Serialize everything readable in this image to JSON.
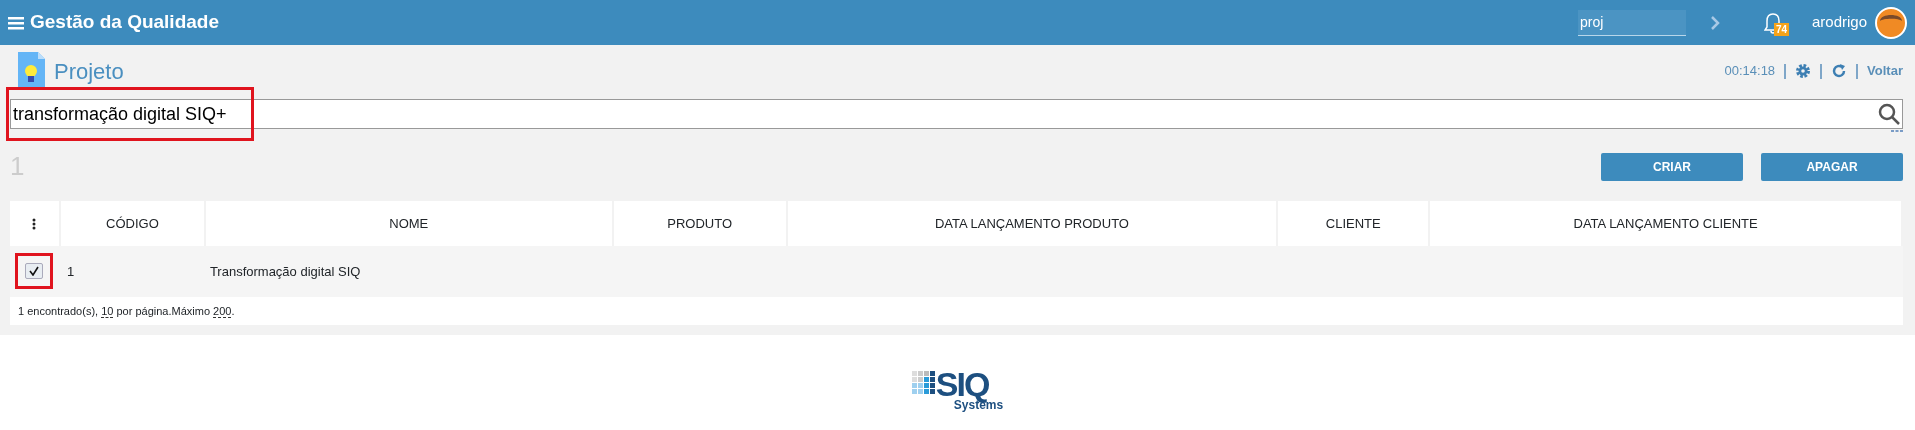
{
  "app": {
    "title": "Gestão da Qualidade",
    "search_value": "proj",
    "notification_count": "74",
    "user": "arodrigo"
  },
  "page": {
    "title": "Projeto",
    "timer": "00:14:18",
    "back_link": "Voltar"
  },
  "search": {
    "value": "transformação digital SIQ+",
    "highlighted": true
  },
  "result_count": "1",
  "buttons": [
    "CRIAR",
    "APAGAR"
  ],
  "table": {
    "columns": [
      "CÓDIGO",
      "NOME",
      "PRODUTO",
      "DATA LANÇAMENTO PRODUTO",
      "CLIENTE",
      "DATA LANÇAMENTO CLIENTE"
    ],
    "rows": [
      {
        "checked": true,
        "highlighted": true,
        "cells": [
          "1",
          "Transformação digital SIQ",
          "",
          "",
          "",
          ""
        ]
      }
    ]
  },
  "footer": {
    "found": "1 encontrado(s),",
    "per_page": "10",
    "per_page_label": "por página.Máximo",
    "max": "200",
    "end": "."
  },
  "logo": {
    "name": "SIQ",
    "subtitle": "Systems"
  }
}
